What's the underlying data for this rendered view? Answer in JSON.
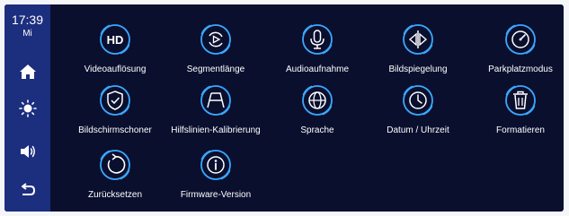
{
  "status": {
    "time": "17:39",
    "day": "Mi"
  },
  "sidebar": {
    "items": [
      {
        "name": "home",
        "icon": "home-icon"
      },
      {
        "name": "brightness",
        "icon": "brightness-icon"
      },
      {
        "name": "volume",
        "icon": "volume-icon"
      },
      {
        "name": "back",
        "icon": "back-icon"
      }
    ]
  },
  "settings": {
    "items": [
      {
        "label": "Videoauflösung",
        "icon": "hd-icon"
      },
      {
        "label": "Segmentlänge",
        "icon": "loop-play-icon"
      },
      {
        "label": "Audioaufnahme",
        "icon": "microphone-icon"
      },
      {
        "label": "Bildspiegelung",
        "icon": "mirror-icon"
      },
      {
        "label": "Parkplatzmodus",
        "icon": "parking-gauge-icon"
      },
      {
        "label": "Bildschirmschoner",
        "icon": "screensaver-shield-icon"
      },
      {
        "label": "Hilfslinien-Kalibrierung",
        "icon": "guideline-icon"
      },
      {
        "label": "Sprache",
        "icon": "globe-icon"
      },
      {
        "label": "Datum / Uhrzeit",
        "icon": "clock-icon"
      },
      {
        "label": "Formatieren",
        "icon": "trash-icon"
      },
      {
        "label": "Zurücksetzen",
        "icon": "reset-icon"
      },
      {
        "label": "Firmware-Version",
        "icon": "info-icon"
      }
    ]
  },
  "colors": {
    "background": "#0a0f2e",
    "sidebar": "#1c2e7e",
    "icon_ring": "#3aa8ff",
    "text": "#ffffff"
  }
}
